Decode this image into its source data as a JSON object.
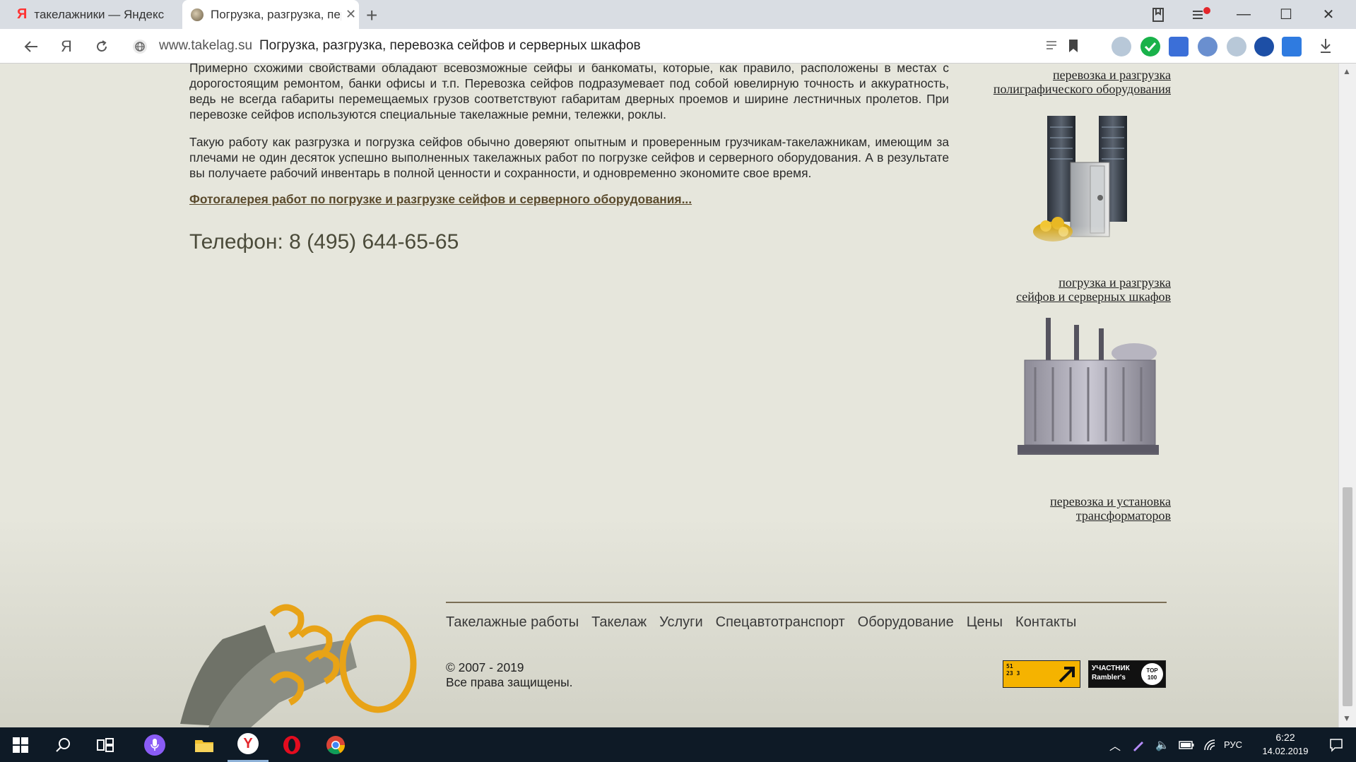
{
  "browser": {
    "tabs": [
      {
        "label": "такелажники — Яндекс: на"
      },
      {
        "label": "Погрузка, разгрузка, пер"
      }
    ],
    "domain": "www.takelag.su",
    "page_title": "Погрузка, разгрузка, перевозка сейфов и серверных шкафов"
  },
  "content": {
    "paragraph1": "Примерно схожими свойствами обладают всевозможные сейфы и банкоматы, которые, как правило, расположены в местах с дорогостоящим ремонтом, банки офисы и т.п. Перевозка сейфов подразумевает под собой ювелирную точность и аккуратность, ведь не всегда габариты перемещаемых грузов соответствуют габаритам дверных проемов и ширине лестничных пролетов. При перевозке сейфов используются специальные такелажные ремни, тележки, роклы.",
    "paragraph2": "Такую работу как разгрузка и погрузка сейфов обычно доверяют опытным и проверенным грузчикам-такелажникам, имеющим за плечами не один десяток успешно выполненных такелажных работ по погрузке сейфов и серверного оборудования. А в результате вы получаете рабочий инвентарь в полной ценности и сохранности, и одновременно экономите свое время.",
    "gallery_link": "Фотогалерея работ по погрузке и разгрузке сейфов и серверного оборудования...",
    "phone": "Телефон: 8 (495) 644-65-65"
  },
  "sidebar": {
    "link1": {
      "line1": "перевозка и разгрузка",
      "line2": "полиграфического оборудования"
    },
    "link2": {
      "line1": "погрузка и разгрузка",
      "line2": "сейфов и серверных шкафов"
    },
    "link3": {
      "line1": "перевозка и установка",
      "line2": "трансформаторов"
    }
  },
  "footer": {
    "nav": [
      "Такелажные работы",
      "Такелаж",
      "Услуги",
      "Спецавтотранспорт",
      "Оборудование",
      "Цены",
      "Контакты"
    ],
    "copyright": "© 2007 - 2019",
    "rights": "Все права защищены.",
    "counter_label": "51 23 3",
    "rambler_label": "УЧАСТНИК Rambler's",
    "rambler_top": "TOP 100"
  },
  "taskbar": {
    "lang": "РУС",
    "time": "6:22",
    "date": "14.02.2019"
  },
  "colors": {
    "page_bg": "#e6e6dc",
    "link_brown": "#5a4a2c",
    "badge_orange": "#f5b300",
    "taskbar_bg": "#0e1a26"
  }
}
